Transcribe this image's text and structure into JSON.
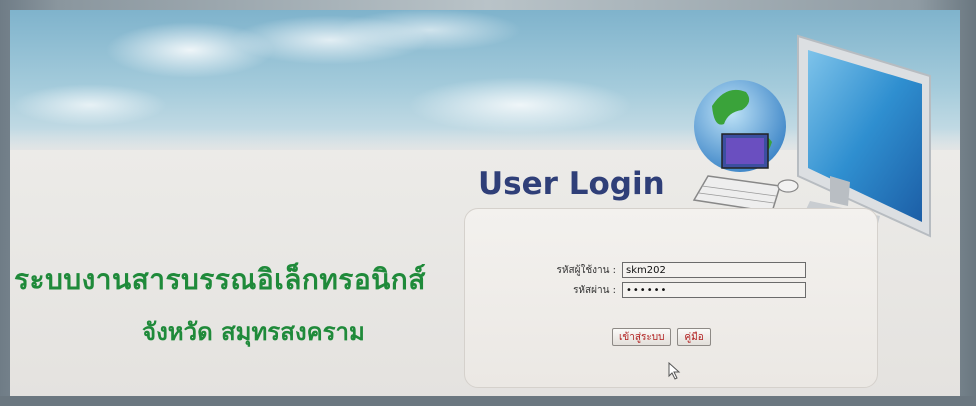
{
  "login": {
    "heading": "User Login",
    "username_label": "รหัสผู้ใช้งาน :",
    "username_value": "skm202",
    "password_label": "รหัสผ่าน :",
    "password_value": "••••••",
    "login_button": "เข้าสู่ระบบ",
    "manual_button": "คู่มือ"
  },
  "branding": {
    "system_title": "ระบบงานสารบรรณอิเล็กทรอนิกส์",
    "province": "จังหวัด สมุทรสงคราม"
  },
  "icons": {
    "monitor_globe": "monitor-globe-icon",
    "cursor": "mouse-cursor-icon"
  },
  "colors": {
    "title_green": "#1f8a3a",
    "heading_navy": "#2f3f78",
    "button_text_red": "#b22020"
  }
}
